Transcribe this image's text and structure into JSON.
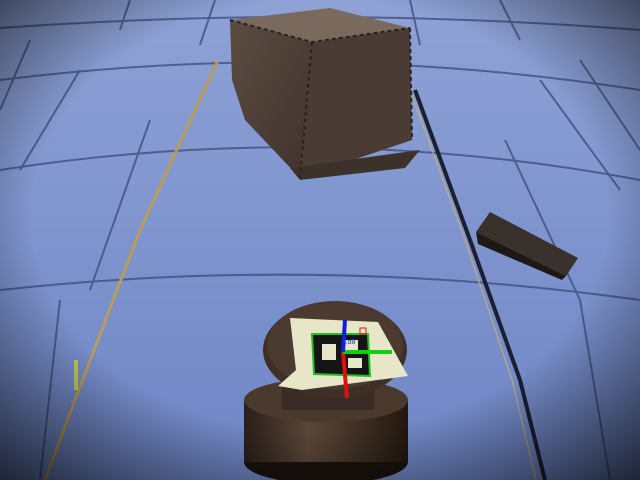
{
  "scene": {
    "description_free": true,
    "colors": {
      "floor_mat": "#6f86c6",
      "floor_mat_light": "#8ea2d6",
      "mat_seams": "#3c4a78",
      "foam_cube": "#5a4a40",
      "obstacle_block": "#2e2724",
      "pedestal": "#3a2c24",
      "marker_paper": "#e8e6c8",
      "marker_black": "#151515",
      "axis_x": "#e01010",
      "axis_y": "#10d010",
      "axis_z": "#1020e0",
      "marker_outline": "#20c020"
    },
    "marker_axis_label": "id0"
  }
}
